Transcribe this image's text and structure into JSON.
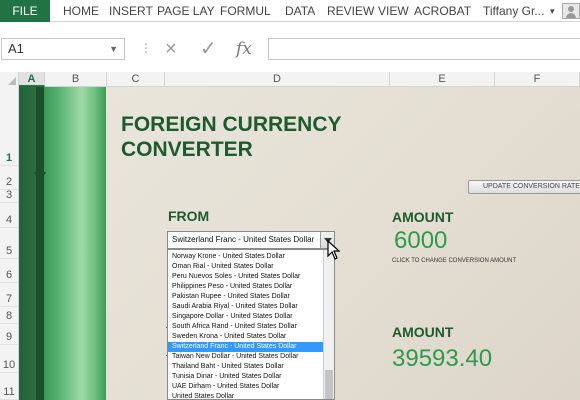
{
  "ribbon": {
    "file_tab": "FILE",
    "tabs": [
      "HOME",
      "INSERT",
      "PAGE LAY",
      "FORMUL",
      "DATA",
      "REVIEW",
      "VIEW",
      "ACROBAT"
    ],
    "user": "Tiffany Gr..."
  },
  "formula_bar": {
    "name_box": "A1",
    "cancel_icon": "×",
    "enter_icon": "✓",
    "function_icon": "fx",
    "formula_value": ""
  },
  "columns": [
    "A",
    "B",
    "C",
    "D",
    "E",
    "F"
  ],
  "selected_column": "A",
  "rows": [
    "1",
    "2",
    "3",
    "4",
    "5",
    "6",
    "7",
    "8",
    "9",
    "10",
    "11"
  ],
  "sheet": {
    "title_line1": "FOREIGN CURRENCY",
    "title_line2": "CONVERTER",
    "update_button": "UPDATE CONVERSION RATES",
    "from_label": "FROM",
    "amount_label_1": "AMOUNT",
    "amount_value_1": "6000",
    "amount_hint": "CLICK TO CHANGE CONVERSION AMOUNT",
    "amount_label_2": "AMOUNT",
    "amount_value_2": "39593.40",
    "dropdown": {
      "selected": "Switzerland Franc - United States Dollar",
      "options": [
        "Norway Krone - United States Dollar",
        "Oman Rial - United States Dollar",
        "Peru Nuevos Soles - United States Dollar",
        "Philippines Peso - United States Dollar",
        "Pakistan Rupee - United States Dollar",
        "Saudi Arabia Riyal - United States Dollar",
        "Singapore Dollar - United States Dollar",
        "South Africa Rand - United States Dollar",
        "Sweden Krona - United States Dollar",
        "Switzerland Franc - United States Dollar",
        "Taiwan New Dollar - United States Dollar",
        "Thailand Baht - United States Dollar",
        "Tunisia Dinar - United States Dollar",
        "UAE Dirham - United States Dollar",
        "United States Dollar"
      ],
      "highlighted_index": 9
    }
  },
  "colors": {
    "excel_green": "#217346",
    "title_green": "#1d5b2f",
    "amount_green": "#2d9a4e",
    "selection_blue": "#3399ff"
  },
  "icons": [
    "user-avatar-icon",
    "cancel-icon",
    "enter-check-icon",
    "function-fx-icon",
    "dropdown-arrow-icon",
    "mouse-pointer-icon"
  ]
}
